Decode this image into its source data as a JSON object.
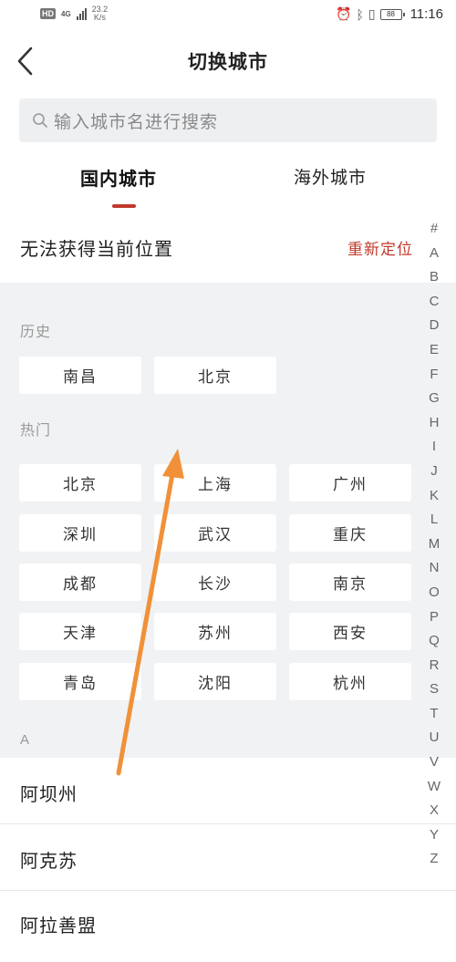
{
  "status_bar": {
    "hd_badge": "HD",
    "network": "4G",
    "speed_value": "23.2",
    "speed_unit": "K/s",
    "battery": "88",
    "time": "11:16"
  },
  "header": {
    "title": "切换城市"
  },
  "search": {
    "placeholder": "输入城市名进行搜索"
  },
  "tabs": [
    {
      "label": "国内城市",
      "active": true
    },
    {
      "label": "海外城市",
      "active": false
    }
  ],
  "location": {
    "label": "无法获得当前位置",
    "action": "重新定位"
  },
  "history": {
    "label": "历史",
    "cities": [
      "南昌",
      "北京"
    ]
  },
  "hot": {
    "label": "热门",
    "cities": [
      "北京",
      "上海",
      "广州",
      "深圳",
      "武汉",
      "重庆",
      "成都",
      "长沙",
      "南京",
      "天津",
      "苏州",
      "西安",
      "青岛",
      "沈阳",
      "杭州"
    ]
  },
  "list": {
    "section_label": "A",
    "cities": [
      "阿坝州",
      "阿克苏",
      "阿拉善盟"
    ]
  },
  "index_bar": [
    "#",
    "A",
    "B",
    "C",
    "D",
    "E",
    "F",
    "G",
    "H",
    "I",
    "J",
    "K",
    "L",
    "M",
    "N",
    "O",
    "P",
    "Q",
    "R",
    "S",
    "T",
    "U",
    "V",
    "W",
    "X",
    "Y",
    "Z"
  ],
  "colors": {
    "accent": "#c0392b",
    "annotation_arrow": "#f0913a",
    "section_bg": "#f1f2f4"
  }
}
